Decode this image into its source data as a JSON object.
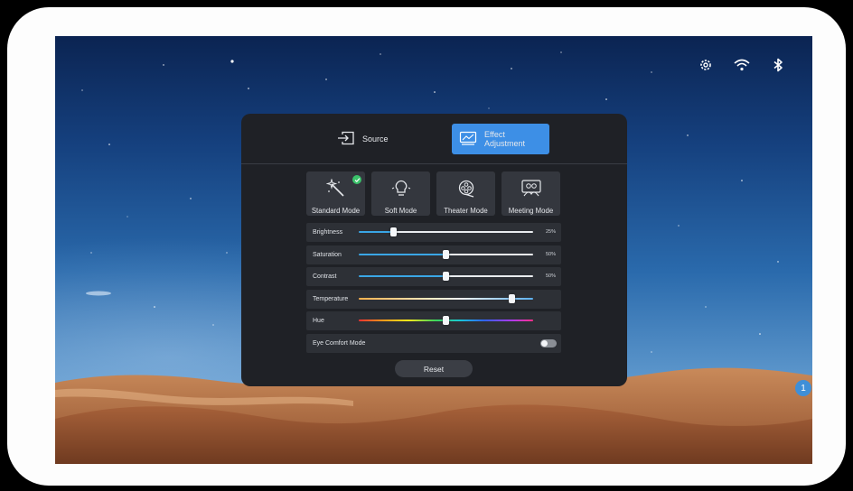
{
  "status_bar": {
    "icons": [
      "gear-icon",
      "wifi-icon",
      "bluetooth-icon"
    ]
  },
  "notification": {
    "count": "1"
  },
  "tabs": [
    {
      "label": "Source",
      "icon": "input-source-icon",
      "active": false
    },
    {
      "label": "Effect Adjustment",
      "icon": "image-adjust-icon",
      "active": true
    }
  ],
  "modes": [
    {
      "label": "Standard Mode",
      "icon": "magic-wand-icon",
      "selected": true
    },
    {
      "label": "Soft Mode",
      "icon": "lightbulb-icon",
      "selected": false
    },
    {
      "label": "Theater Mode",
      "icon": "film-reel-icon",
      "selected": false
    },
    {
      "label": "Meeting Mode",
      "icon": "meeting-icon",
      "selected": false
    }
  ],
  "sliders": {
    "brightness": {
      "label": "Brightness",
      "value": "25%",
      "level": 0.2
    },
    "saturation": {
      "label": "Saturation",
      "value": "50%",
      "level": 0.5
    },
    "contrast": {
      "label": "Contrast",
      "value": "50%",
      "level": 0.5
    },
    "temperature": {
      "label": "Temperature",
      "level": 0.88
    },
    "hue": {
      "label": "Hue",
      "level": 0.5
    }
  },
  "eye_comfort": {
    "label": "Eye Comfort Mode",
    "enabled": false
  },
  "reset_label": "Reset",
  "colors": {
    "accent": "#3d8fe6",
    "panel_bg": "#1f2126",
    "check": "#3ac26a"
  }
}
